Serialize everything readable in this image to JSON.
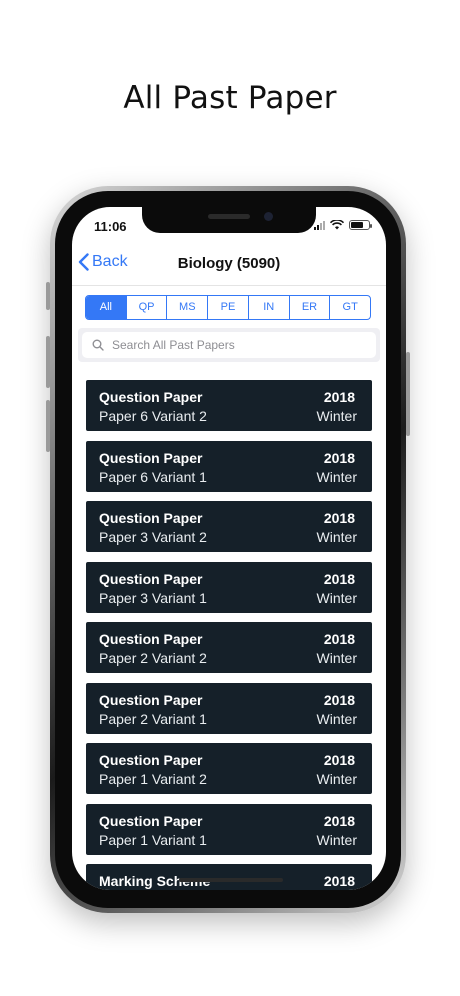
{
  "headline": "All Past Paper",
  "status": {
    "time": "11:06"
  },
  "nav": {
    "back": "Back",
    "title": "Biology (5090)"
  },
  "segments": [
    "All",
    "QP",
    "MS",
    "PE",
    "IN",
    "ER",
    "GT"
  ],
  "active_segment": "All",
  "search": {
    "placeholder": "Search All Past Papers",
    "value": ""
  },
  "papers": [
    {
      "type": "Question Paper",
      "variant": "Paper 6 Variant 2",
      "year": "2018",
      "season": "Winter"
    },
    {
      "type": "Question Paper",
      "variant": "Paper 6 Variant 1",
      "year": "2018",
      "season": "Winter"
    },
    {
      "type": "Question Paper",
      "variant": "Paper 3 Variant 2",
      "year": "2018",
      "season": "Winter"
    },
    {
      "type": "Question Paper",
      "variant": "Paper 3 Variant 1",
      "year": "2018",
      "season": "Winter"
    },
    {
      "type": "Question Paper",
      "variant": "Paper 2 Variant 2",
      "year": "2018",
      "season": "Winter"
    },
    {
      "type": "Question Paper",
      "variant": "Paper 2 Variant 1",
      "year": "2018",
      "season": "Winter"
    },
    {
      "type": "Question Paper",
      "variant": "Paper 1 Variant 2",
      "year": "2018",
      "season": "Winter"
    },
    {
      "type": "Question Paper",
      "variant": "Paper 1 Variant 1",
      "year": "2018",
      "season": "Winter"
    },
    {
      "type": "Marking Scheme",
      "variant": "",
      "year": "2018",
      "season": ""
    }
  ],
  "colors": {
    "accent": "#3478f6",
    "card_bg": "#152029"
  }
}
